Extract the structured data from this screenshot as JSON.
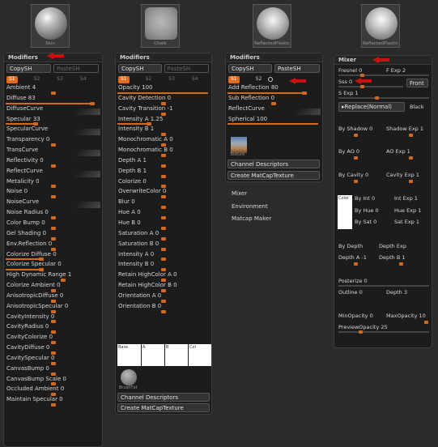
{
  "thumbnails": [
    {
      "caption": "Skin"
    },
    {
      "caption": "Chalk"
    },
    {
      "caption": "ReflectedPlastic"
    },
    {
      "caption": "ReflectedPlastic"
    }
  ],
  "panel1": {
    "title": "Modifiers",
    "copy_label": "CopySH",
    "paste_label": "PasteSH",
    "channels": [
      "S1",
      "S2",
      "S3",
      "S4"
    ],
    "items": [
      "Ambient 4",
      "Diffuse 83",
      "DiffuseCurve",
      "Specular 33",
      "SpecularCurve",
      "Transparency 0",
      "TransCurve",
      "Reflectivity 0",
      "ReflectCurve",
      "Metalicity 0",
      "Noise 0",
      "NoiseCurve",
      "Noise Radius 0",
      "Color Bump 0",
      "Gel Shading 0",
      "Env.Reflection 0",
      "Colorize Diffuse 0",
      "Colorize Specular 0",
      "High Dynamic Range 1",
      "Colorize Ambient 0",
      "AnisotropicDiffuse 0",
      "AnisotropicSpecular 0",
      "CavityIntensity 0",
      "CavityRadius 0",
      "CavityColorize 0",
      "CavityDiffuse 0",
      "CavitySpecular 0",
      "CanvasBump 0",
      "CanvasBump Scale 0",
      "Occluded Ambient 0",
      "Maintain Specular 0"
    ]
  },
  "panel2": {
    "title": "Modifiers",
    "copy_label": "CopySH",
    "paste_label": "PasteSH",
    "channels": [
      "S1",
      "S2",
      "S3",
      "S4"
    ],
    "items": [
      "Opacity 100",
      "Cavity Detection 0",
      "Cavity Transition -1",
      "Intensity A 1.25",
      "Intensity B 1",
      "Monochromatic A 0",
      "Monochromatic B 0",
      "Depth A 1",
      "Depth B 1",
      "Colorize 0",
      "OverwriteColor 0",
      "Blur 0",
      "Hue A 0",
      "Hue B 0",
      "Saturation A 0",
      "Saturation B 0",
      "Intensity A 0",
      "Intensity B 0",
      "Retain HighColor A 0",
      "Retain HighColor B 0",
      "Orientation A 0",
      "Orientation B 0"
    ],
    "swatches": [
      "Base",
      "A",
      "B",
      "Col"
    ],
    "brush_label": "BrushTxt",
    "channel_desc": "Channel Descriptors",
    "create_matcap": "Create MatCapTexture"
  },
  "panel3": {
    "copy_label": "CopySH",
    "paste_label": "PasteSH",
    "channels": [
      "S1",
      "S2"
    ],
    "items": [
      "Add Reflection 80",
      "Sub Reflection 0",
      "ReflectCurve",
      "Spherical 100"
    ],
    "texture_label": "Texture",
    "channel_desc": "Channel Descriptors",
    "create_matcap": "Create MatCapTexture"
  },
  "loose_labels": [
    "Mixer",
    "Environment",
    "Matcap Maker"
  ],
  "mixer": {
    "title": "Mixer",
    "fresnel": "Fresnel 0",
    "f_exp": "F Exp 2",
    "sss": "Sss 0",
    "front": "Front",
    "s_exp": "S Exp 1",
    "replace": "Replace(Normal)",
    "black": "Black",
    "by_shadow": "By Shadow 0",
    "shadow_exp": "Shadow Exp 1",
    "by_ao": "By AO 0",
    "ao_exp": "AO Exp 1",
    "by_cavity": "By Cavity 0",
    "cavity_exp": "Cavity Exp 1",
    "color_label": "Color",
    "by_int": "By Int 0",
    "int_exp": "Int Exp 1",
    "by_hue": "By Hue 0",
    "hue_exp": "Hue Exp 1",
    "by_sat": "By Sat 0",
    "sat_exp": "Sat Exp 1",
    "by_depth": "By Depth",
    "depth_exp": "Depth Exp",
    "depth_a": "Depth A -1",
    "depth_b": "Depth B 1",
    "posterize": "Posterize 0",
    "outline": "Outline 0",
    "depth": "Depth 3",
    "min_opacity": "MinOpacity 0",
    "max_opacity": "MaxOpacity 10",
    "preview_opacity": "PreviewOpacity 25"
  },
  "colors": {
    "accent": "#d2691e",
    "arrow": "#cc1111",
    "panel_bg": "#1c1c1c"
  }
}
